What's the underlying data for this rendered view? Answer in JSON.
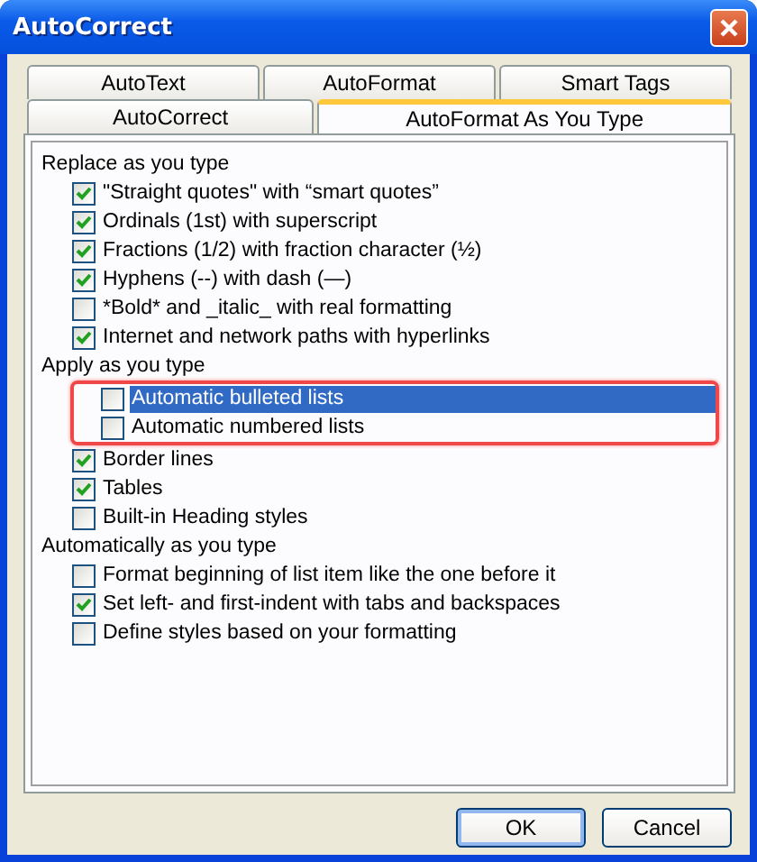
{
  "window": {
    "title": "AutoCorrect"
  },
  "tab_rows": [
    {
      "tabs": [
        {
          "label": "AutoText",
          "selected": false
        },
        {
          "label": "AutoFormat",
          "selected": false
        },
        {
          "label": "Smart Tags",
          "selected": false
        }
      ]
    },
    {
      "tabs": [
        {
          "label": "AutoCorrect",
          "selected": false
        },
        {
          "label": "AutoFormat As You Type",
          "selected": true
        }
      ]
    }
  ],
  "sections": [
    {
      "heading": "Replace as you type",
      "items": [
        {
          "label": "\"Straight quotes\" with “smart quotes”",
          "checked": true,
          "selected": false,
          "outlined": false
        },
        {
          "label": "Ordinals (1st) with superscript",
          "checked": true,
          "selected": false,
          "outlined": false
        },
        {
          "label": "Fractions (1/2) with fraction character (½)",
          "checked": true,
          "selected": false,
          "outlined": false
        },
        {
          "label": "Hyphens (--) with dash (—)",
          "checked": true,
          "selected": false,
          "outlined": false
        },
        {
          "label": "*Bold* and _italic_ with real formatting",
          "checked": false,
          "selected": false,
          "outlined": false
        },
        {
          "label": "Internet and network paths with hyperlinks",
          "checked": true,
          "selected": false,
          "outlined": false
        }
      ]
    },
    {
      "heading": "Apply as you type",
      "items": [
        {
          "label": "Automatic bulleted lists",
          "checked": false,
          "selected": true,
          "outlined": true
        },
        {
          "label": "Automatic numbered lists",
          "checked": false,
          "selected": false,
          "outlined": true
        },
        {
          "label": "Border lines",
          "checked": true,
          "selected": false,
          "outlined": false
        },
        {
          "label": "Tables",
          "checked": true,
          "selected": false,
          "outlined": false
        },
        {
          "label": "Built-in Heading styles",
          "checked": false,
          "selected": false,
          "outlined": false
        }
      ]
    },
    {
      "heading": "Automatically as you type",
      "items": [
        {
          "label": "Format beginning of list item like the one before it",
          "checked": false,
          "selected": false,
          "outlined": false
        },
        {
          "label": "Set left- and first-indent with tabs and backspaces",
          "checked": true,
          "selected": false,
          "outlined": false
        },
        {
          "label": "Define styles based on your formatting",
          "checked": false,
          "selected": false,
          "outlined": false
        }
      ]
    }
  ],
  "buttons": [
    {
      "label": "OK",
      "default": true
    },
    {
      "label": "Cancel",
      "default": false
    }
  ]
}
